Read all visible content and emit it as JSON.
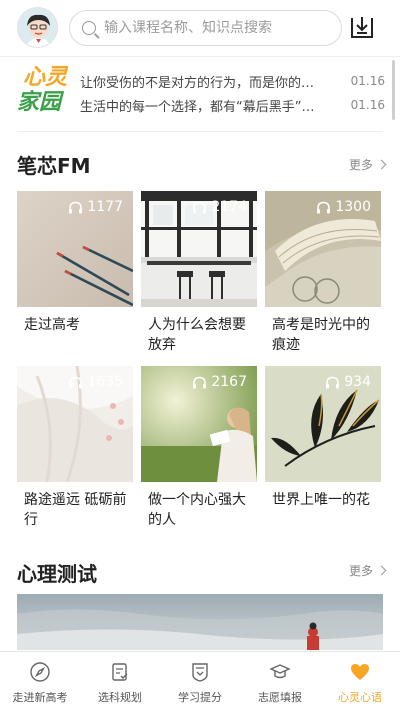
{
  "header": {
    "search_placeholder": "输入课程名称、知识点搜索"
  },
  "news": {
    "logo_line1": "心灵",
    "logo_line2": "家园",
    "items": [
      {
        "text": "让你受伤的不是对方的行为，而是你的…",
        "date": "01.16"
      },
      {
        "text": "生活中的每一个选择，都有“幕后黑手”…",
        "date": "01.16"
      }
    ]
  },
  "fm": {
    "title": "笔芯FM",
    "more": "更多",
    "items": [
      {
        "count": "1177",
        "title": "走过高考"
      },
      {
        "count": "2174",
        "title": "人为什么会想要放弃"
      },
      {
        "count": "1300",
        "title": "高考是时光中的痕迹"
      },
      {
        "count": "1635",
        "title": "路途遥远 砥砺前行"
      },
      {
        "count": "2167",
        "title": "做一个内心强大的人"
      },
      {
        "count": "934",
        "title": "世界上唯一的花"
      }
    ]
  },
  "test": {
    "title": "心理测试",
    "more": "更多"
  },
  "tabs": [
    {
      "label": "走进新高考",
      "icon": "compass-icon"
    },
    {
      "label": "选科规划",
      "icon": "checklist-icon"
    },
    {
      "label": "学习提分",
      "icon": "shield-badge-icon"
    },
    {
      "label": "志愿填报",
      "icon": "graduation-cap-icon"
    },
    {
      "label": "心灵心语",
      "icon": "heart-icon",
      "active": true
    }
  ],
  "colors": {
    "accent": "#f5a623",
    "logo_green": "#3aa14a"
  }
}
